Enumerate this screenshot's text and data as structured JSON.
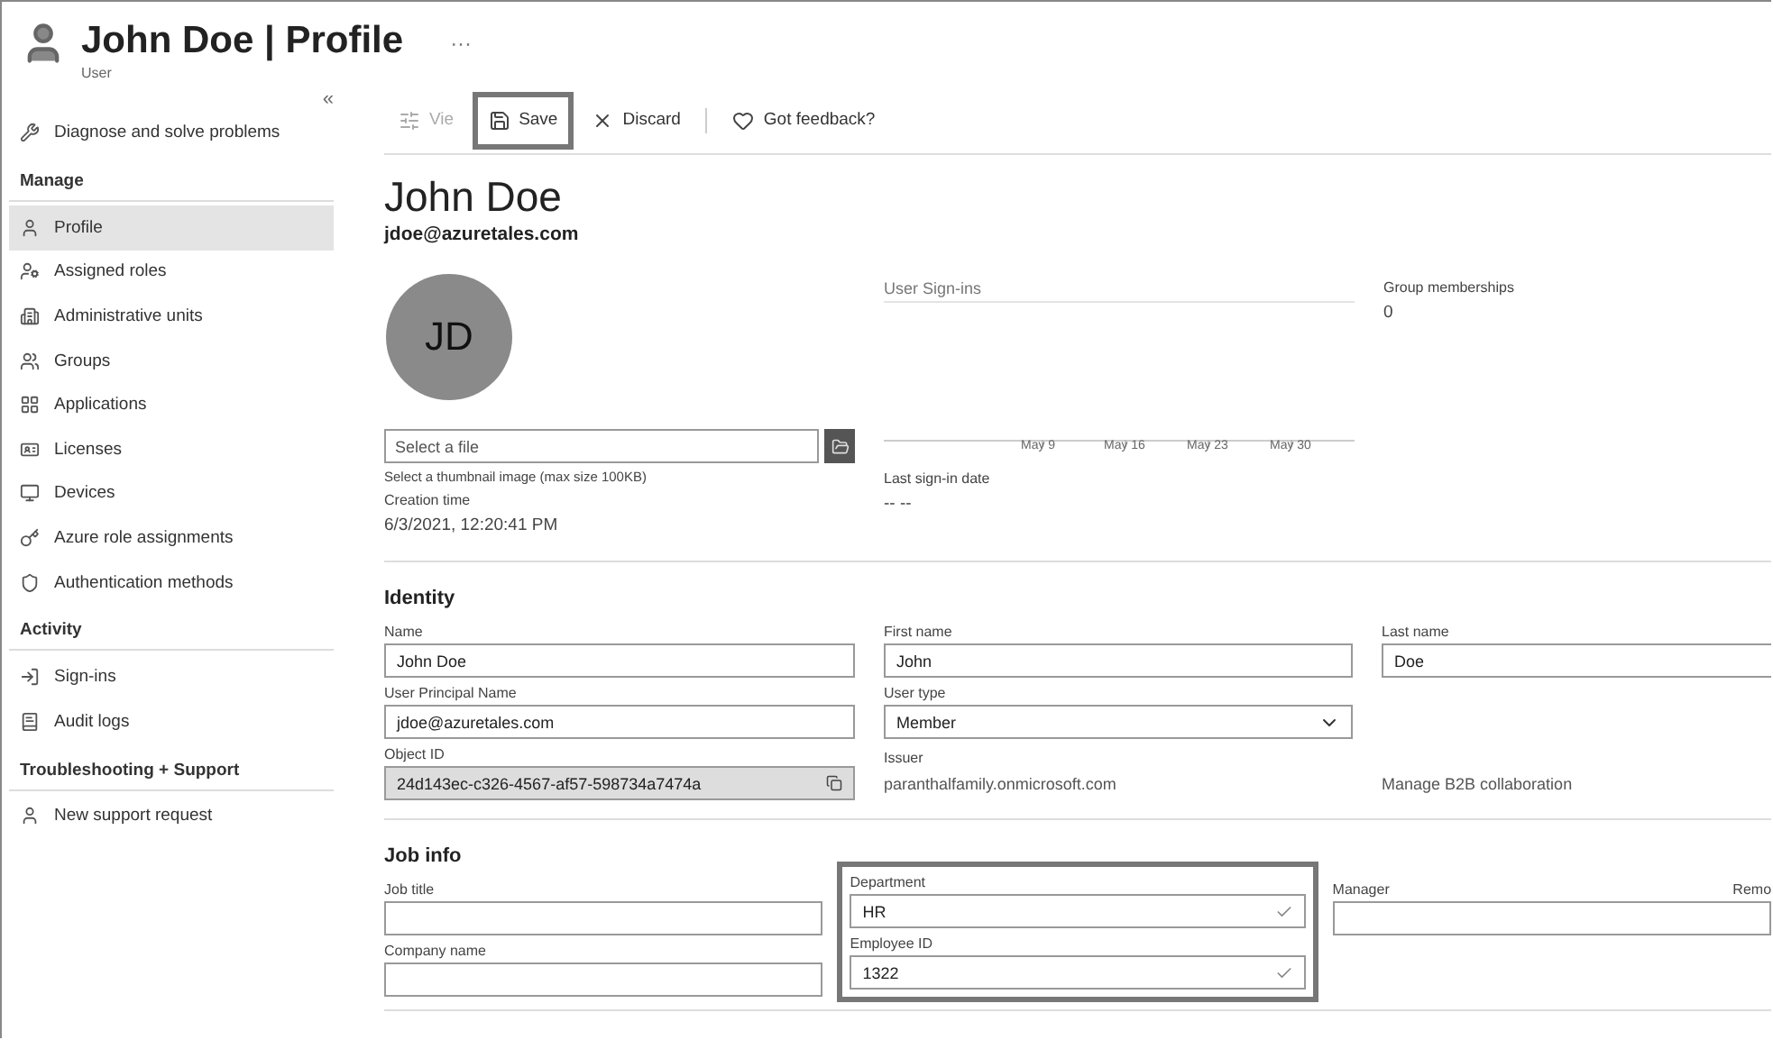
{
  "header": {
    "title": "John Doe | Profile",
    "subtitle": "User",
    "more": "···"
  },
  "sidebar": {
    "collapse": "«",
    "top_items": [
      {
        "label": "Diagnose and solve problems",
        "selected": false
      }
    ],
    "groups": [
      {
        "title": "Manage",
        "items": [
          {
            "label": "Profile",
            "selected": true
          },
          {
            "label": "Assigned roles",
            "selected": false
          },
          {
            "label": "Administrative units",
            "selected": false
          },
          {
            "label": "Groups",
            "selected": false
          },
          {
            "label": "Applications",
            "selected": false
          },
          {
            "label": "Licenses",
            "selected": false
          },
          {
            "label": "Devices",
            "selected": false
          },
          {
            "label": "Azure role assignments",
            "selected": false
          },
          {
            "label": "Authentication methods",
            "selected": false
          }
        ]
      },
      {
        "title": "Activity",
        "items": [
          {
            "label": "Sign-ins",
            "selected": false
          },
          {
            "label": "Audit logs",
            "selected": false
          }
        ]
      },
      {
        "title": "Troubleshooting + Support",
        "items": [
          {
            "label": "New support request",
            "selected": false
          }
        ]
      }
    ]
  },
  "toolbar": [
    {
      "kind": "view",
      "label": "Vie",
      "disabled": true,
      "highlighted": false
    },
    {
      "kind": "save",
      "label": "Save",
      "disabled": false,
      "highlighted": true
    },
    {
      "kind": "discard",
      "label": "Discard",
      "disabled": false,
      "highlighted": false
    },
    {
      "kind": "feedback",
      "label": "Got feedback?",
      "disabled": false,
      "highlighted": false
    }
  ],
  "profile": {
    "name": "John Doe",
    "email": "jdoe@azuretales.com",
    "initials": "JD",
    "file": {
      "placeholder": "Select a file",
      "hint": "Select a thumbnail image (max size 100KB)"
    },
    "creation": {
      "label": "Creation time",
      "value": "6/3/2021, 12:20:41 PM"
    },
    "sign_ins": {
      "title": "User Sign-ins",
      "x_labels": [
        "May 9",
        "May 16",
        "May 23",
        "May 30"
      ]
    },
    "last_sign_in": {
      "label": "Last sign-in date",
      "value": "-- --"
    },
    "groups": {
      "label": "Group memberships",
      "value": "0"
    }
  },
  "identity": {
    "title": "Identity",
    "rows": [
      [
        {
          "kind": "input",
          "label": "Name",
          "value": "John Doe"
        },
        {
          "kind": "input",
          "label": "First name",
          "value": "John"
        },
        {
          "kind": "input",
          "label": "Last name",
          "value": "Doe"
        }
      ],
      [
        {
          "kind": "input",
          "label": "User Principal Name",
          "value": "jdoe@azuretales.com"
        },
        {
          "kind": "select",
          "label": "User type",
          "value": "Member"
        }
      ],
      [
        {
          "kind": "readonly",
          "label": "Object ID",
          "value": "24d143ec-c326-4567-af57-598734a7474a"
        },
        {
          "kind": "plain",
          "label": "Issuer",
          "value": "paranthalfamily.onmicrosoft.com"
        },
        {
          "kind": "link",
          "value": "Manage B2B collaboration"
        }
      ]
    ]
  },
  "job_info": {
    "title": "Job info",
    "columns": [
      {
        "highlighted": false,
        "fields": [
          {
            "label": "Job title",
            "validated": false
          },
          {
            "label": "Company name",
            "validated": false
          }
        ]
      },
      {
        "highlighted": true,
        "fields": [
          {
            "label": "Department",
            "value": "HR",
            "validated": true
          },
          {
            "label": "Employee ID",
            "value": "1322",
            "validated": true
          }
        ]
      },
      {
        "highlighted": false,
        "fields": [
          {
            "label": "Manager",
            "action": "Remo",
            "validated": false
          }
        ]
      }
    ]
  }
}
